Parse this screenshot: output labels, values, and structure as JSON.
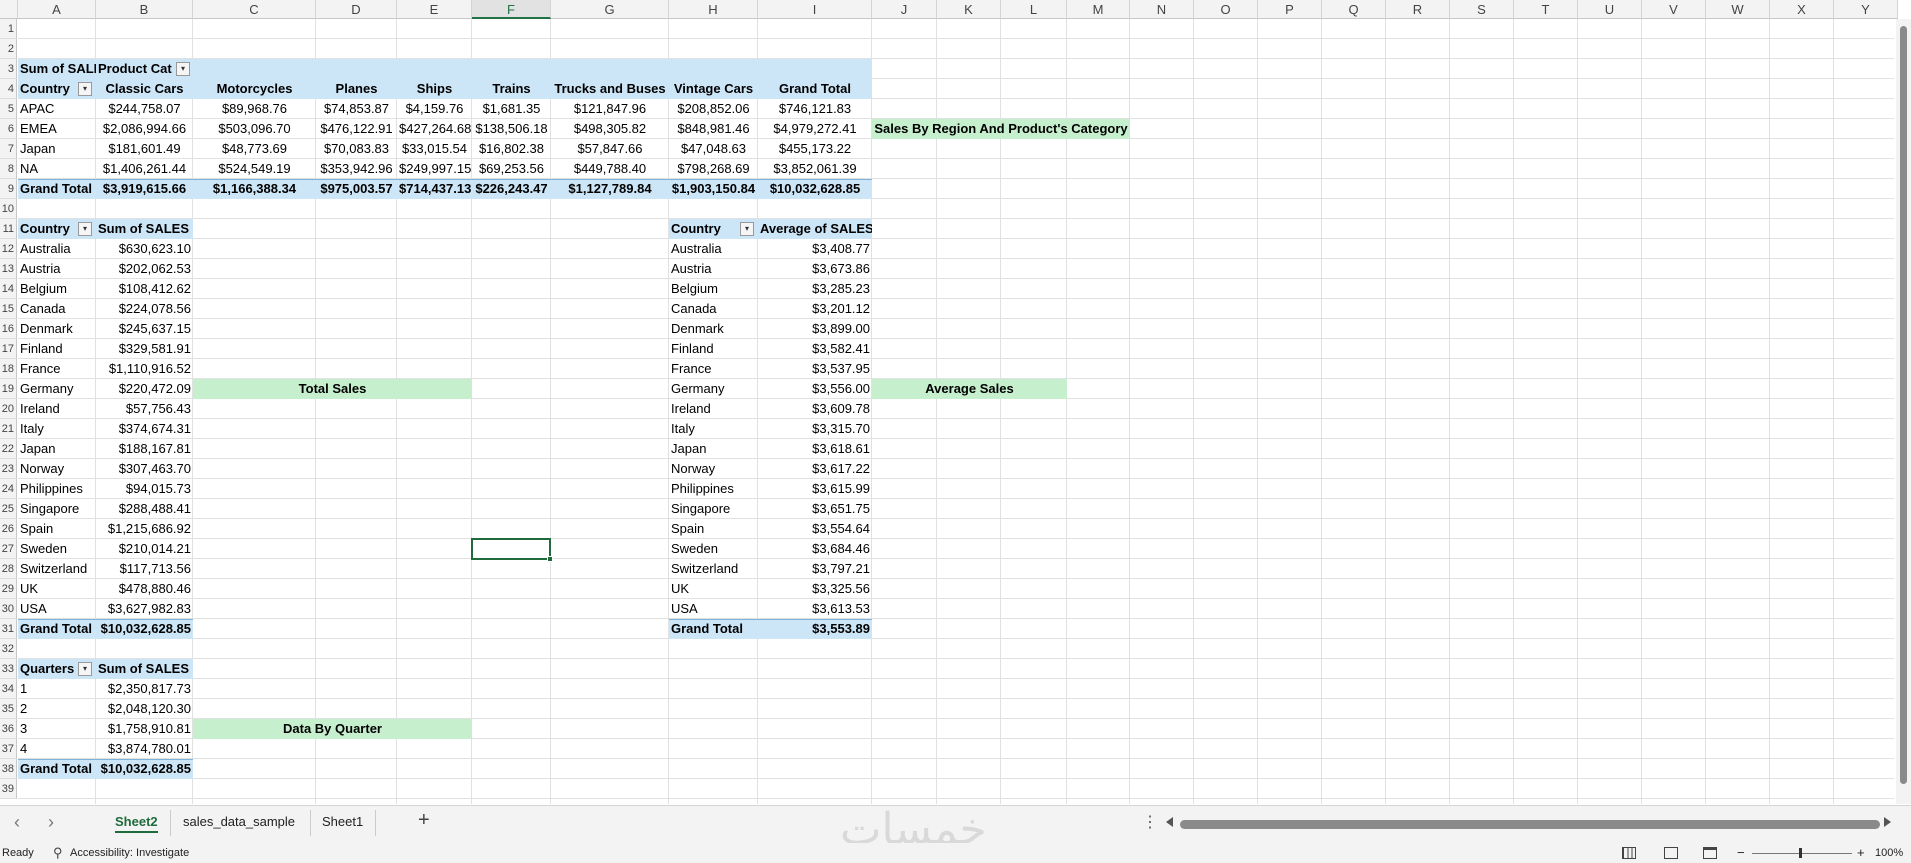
{
  "columns": [
    "A",
    "B",
    "C",
    "D",
    "E",
    "F",
    "G",
    "H",
    "I",
    "J",
    "K",
    "L",
    "M",
    "N",
    "O",
    "P",
    "Q",
    "R",
    "S",
    "T",
    "U",
    "V",
    "W",
    "X",
    "Y"
  ],
  "selected_column": "F",
  "rows": [
    "1",
    "2",
    "3",
    "4",
    "5",
    "6",
    "7",
    "8",
    "9",
    "10",
    "11",
    "12",
    "13",
    "14",
    "15",
    "16",
    "17",
    "18",
    "19",
    "20",
    "21",
    "22",
    "23",
    "24",
    "25",
    "26",
    "27",
    "28",
    "29",
    "30",
    "31",
    "32",
    "33",
    "34",
    "35",
    "36",
    "37",
    "38",
    "39"
  ],
  "pivot1": {
    "corner": "Sum of SALES",
    "col_field": "Product Cat",
    "row_field": "Country",
    "headers": [
      "Classic Cars",
      "Motorcycles",
      "Planes",
      "Ships",
      "Trains",
      "Trucks and Buses",
      "Vintage Cars",
      "Grand Total"
    ],
    "rows": [
      {
        "label": "APAC",
        "values": [
          "$244,758.07",
          "$89,968.76",
          "$74,853.87",
          "$4,159.76",
          "$1,681.35",
          "$121,847.96",
          "$208,852.06",
          "$746,121.83"
        ]
      },
      {
        "label": "EMEA",
        "values": [
          "$2,086,994.66",
          "$503,096.70",
          "$476,122.91",
          "$427,264.68",
          "$138,506.18",
          "$498,305.82",
          "$848,981.46",
          "$4,979,272.41"
        ]
      },
      {
        "label": "Japan",
        "values": [
          "$181,601.49",
          "$48,773.69",
          "$70,083.83",
          "$33,015.54",
          "$16,802.38",
          "$57,847.66",
          "$47,048.63",
          "$455,173.22"
        ]
      },
      {
        "label": "NA",
        "values": [
          "$1,406,261.44",
          "$524,549.19",
          "$353,942.96",
          "$249,997.15",
          "$69,253.56",
          "$449,788.40",
          "$798,268.69",
          "$3,852,061.39"
        ]
      }
    ],
    "total_label": "Grand Total",
    "totals": [
      "$3,919,615.66",
      "$1,166,388.34",
      "$975,003.57",
      "$714,437.13",
      "$226,243.47",
      "$1,127,789.84",
      "$1,903,150.84",
      "$10,032,628.85"
    ]
  },
  "label_region": "Sales By Region And Product's Category",
  "pivot2": {
    "row_field": "Country",
    "value_field": "Sum of SALES",
    "rows": [
      {
        "label": "Australia",
        "value": "$630,623.10"
      },
      {
        "label": "Austria",
        "value": "$202,062.53"
      },
      {
        "label": "Belgium",
        "value": "$108,412.62"
      },
      {
        "label": "Canada",
        "value": "$224,078.56"
      },
      {
        "label": "Denmark",
        "value": "$245,637.15"
      },
      {
        "label": "Finland",
        "value": "$329,581.91"
      },
      {
        "label": "France",
        "value": "$1,110,916.52"
      },
      {
        "label": "Germany",
        "value": "$220,472.09"
      },
      {
        "label": "Ireland",
        "value": "$57,756.43"
      },
      {
        "label": "Italy",
        "value": "$374,674.31"
      },
      {
        "label": "Japan",
        "value": "$188,167.81"
      },
      {
        "label": "Norway",
        "value": "$307,463.70"
      },
      {
        "label": "Philippines",
        "value": "$94,015.73"
      },
      {
        "label": "Singapore",
        "value": "$288,488.41"
      },
      {
        "label": "Spain",
        "value": "$1,215,686.92"
      },
      {
        "label": "Sweden",
        "value": "$210,014.21"
      },
      {
        "label": "Switzerland",
        "value": "$117,713.56"
      },
      {
        "label": "UK",
        "value": "$478,880.46"
      },
      {
        "label": "USA",
        "value": "$3,627,982.83"
      }
    ],
    "total_label": "Grand Total",
    "total": "$10,032,628.85"
  },
  "label_total_sales": "Total Sales",
  "pivot3": {
    "row_field": "Country",
    "value_field": "Average of SALES",
    "rows": [
      {
        "label": "Australia",
        "value": "$3,408.77"
      },
      {
        "label": "Austria",
        "value": "$3,673.86"
      },
      {
        "label": "Belgium",
        "value": "$3,285.23"
      },
      {
        "label": "Canada",
        "value": "$3,201.12"
      },
      {
        "label": "Denmark",
        "value": "$3,899.00"
      },
      {
        "label": "Finland",
        "value": "$3,582.41"
      },
      {
        "label": "France",
        "value": "$3,537.95"
      },
      {
        "label": "Germany",
        "value": "$3,556.00"
      },
      {
        "label": "Ireland",
        "value": "$3,609.78"
      },
      {
        "label": "Italy",
        "value": "$3,315.70"
      },
      {
        "label": "Japan",
        "value": "$3,618.61"
      },
      {
        "label": "Norway",
        "value": "$3,617.22"
      },
      {
        "label": "Philippines",
        "value": "$3,615.99"
      },
      {
        "label": "Singapore",
        "value": "$3,651.75"
      },
      {
        "label": "Spain",
        "value": "$3,554.64"
      },
      {
        "label": "Sweden",
        "value": "$3,684.46"
      },
      {
        "label": "Switzerland",
        "value": "$3,797.21"
      },
      {
        "label": "UK",
        "value": "$3,325.56"
      },
      {
        "label": "USA",
        "value": "$3,613.53"
      }
    ],
    "total_label": "Grand Total",
    "total": "$3,553.89"
  },
  "label_average_sales": "Average Sales",
  "pivot4": {
    "row_field": "Quarters",
    "value_field": "Sum of SALES",
    "rows": [
      {
        "label": "1",
        "value": "$2,350,817.73"
      },
      {
        "label": "2",
        "value": "$2,048,120.30"
      },
      {
        "label": "3",
        "value": "$1,758,910.81"
      },
      {
        "label": "4",
        "value": "$3,874,780.01"
      }
    ],
    "total_label": "Grand Total",
    "total": "$10,032,628.85"
  },
  "label_quarter": "Data By Quarter",
  "tabs": [
    "Sheet2",
    "sales_data_sample",
    "Sheet1"
  ],
  "active_tab": "Sheet2",
  "add_sheet": "+",
  "nav_prev": "‹",
  "nav_next": "›",
  "more_options": "⋮",
  "status": {
    "ready": "Ready",
    "accessibility": "Accessibility: Investigate",
    "zoom": "100%",
    "zoom_minus": "−",
    "zoom_plus": "+"
  },
  "watermark": "خمسات",
  "colors": {
    "pivot_header": "#cde6f7",
    "label_fill": "#c6efce",
    "excel_green": "#1f6b3c"
  }
}
